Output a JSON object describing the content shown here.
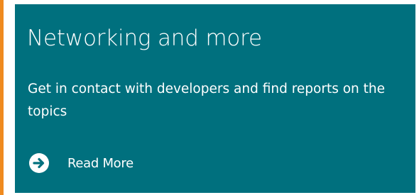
{
  "tile": {
    "title": "Networking and more",
    "description": "Get in contact with developers and find reports on the topics",
    "link_label": "Read More",
    "link_icon": "arrow-right-circle-icon"
  },
  "colors": {
    "tile_background": "#00707e",
    "accent": "#ef8a1f",
    "text": "#ffffff"
  }
}
